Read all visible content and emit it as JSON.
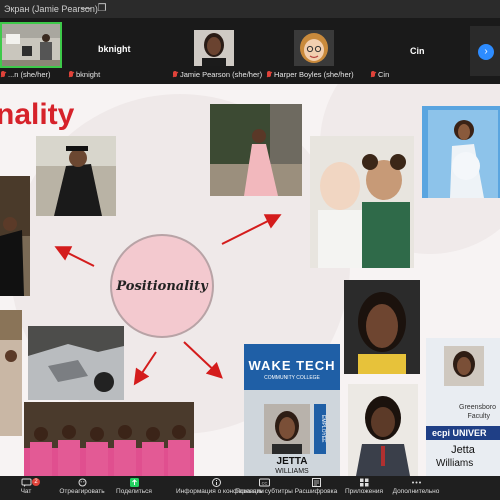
{
  "window": {
    "title": "Экран (Jamie Pearson)"
  },
  "participants": [
    {
      "label": "...n (she/her)",
      "muted": true
    },
    {
      "label": "bknight",
      "muted": true,
      "display_name": "bknight"
    },
    {
      "label": "Jamie Pearson (she/her)",
      "muted": true
    },
    {
      "label": "Harper Boyles (she/her)",
      "muted": true
    },
    {
      "label": "Cin",
      "muted": true,
      "display_name": "Cin"
    }
  ],
  "slide": {
    "title_fragment": "nality",
    "center_label": "Positionality",
    "badge_wake": {
      "college": "WAKE TECH",
      "subtitle": "COMMUNITY COLLEGE",
      "employee": "EMPLOYEE",
      "first": "JETTA",
      "last": "WILLIAMS"
    },
    "badge_ecpi": {
      "line1": "Greensboro",
      "line2": "Faculty",
      "brand": "ecpi UNIVER",
      "first": "Jetta",
      "last": "Williams"
    }
  },
  "toolbar": {
    "items": [
      {
        "label": "Чат",
        "icon": "chat-icon",
        "badge": "2"
      },
      {
        "label": "Отреагировать",
        "icon": "react-icon"
      },
      {
        "label": "Поделиться",
        "icon": "share-icon"
      },
      {
        "label": "Информация о конференции",
        "icon": "info-icon"
      },
      {
        "label": "Показать субтитры",
        "icon": "cc-icon"
      },
      {
        "label": "Расшифровка",
        "icon": "transcript-icon"
      },
      {
        "label": "Приложения",
        "icon": "apps-icon"
      },
      {
        "label": "Дополнительно",
        "icon": "more-icon"
      }
    ]
  },
  "colors": {
    "accent": "#2d8cff",
    "title_red": "#d6222a",
    "arrow_red": "#d41c1c",
    "share_green": "#23d160",
    "mute_red": "#e0433a"
  }
}
